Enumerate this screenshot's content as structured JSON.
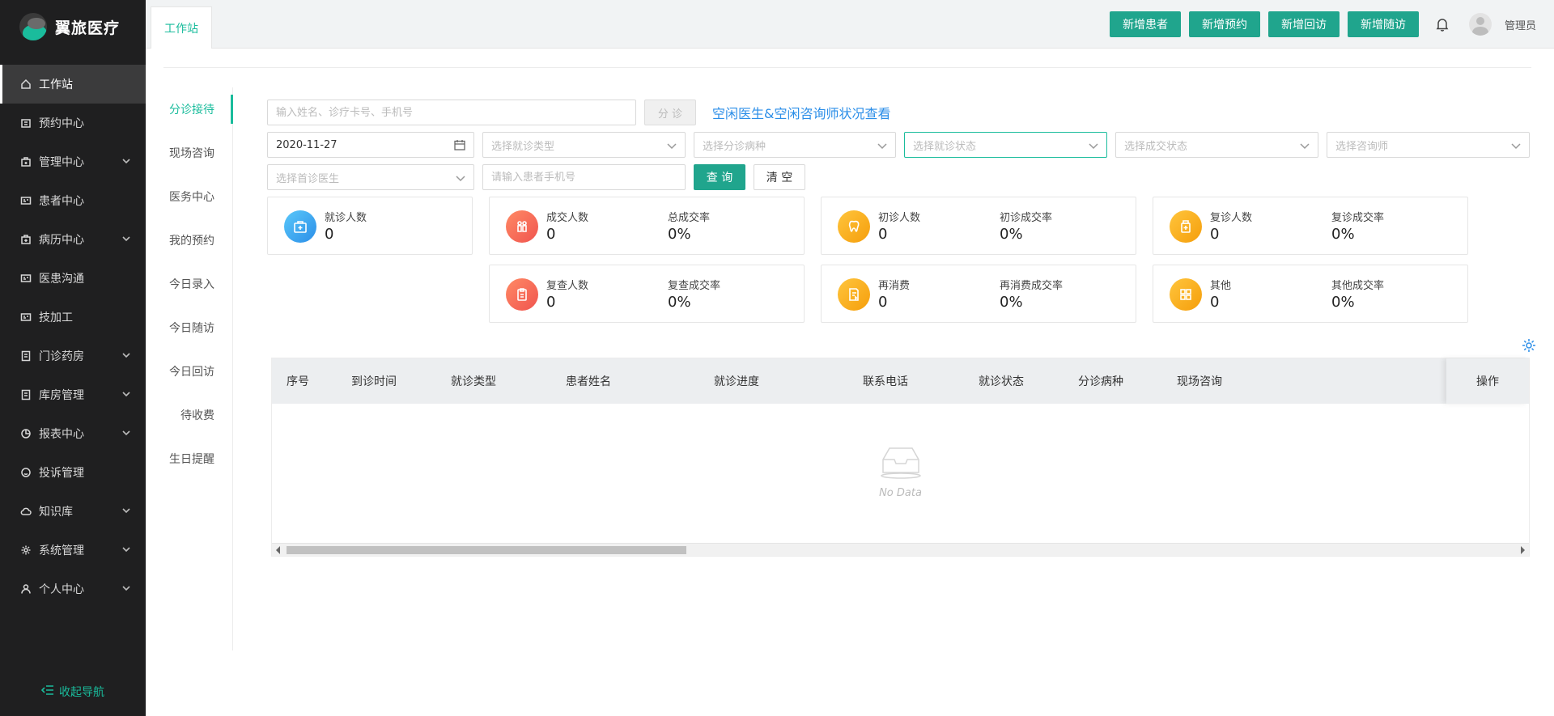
{
  "app": {
    "name": "翼旅医疗"
  },
  "sidebar": {
    "items": [
      {
        "label": "工作站",
        "icon": "home-icon",
        "expandable": false,
        "active": true
      },
      {
        "label": "预约中心",
        "icon": "calendar-icon",
        "expandable": false
      },
      {
        "label": "管理中心",
        "icon": "briefcase-icon",
        "expandable": true
      },
      {
        "label": "患者中心",
        "icon": "id-card-icon",
        "expandable": false
      },
      {
        "label": "病历中心",
        "icon": "medical-case-icon",
        "expandable": true
      },
      {
        "label": "医患沟通",
        "icon": "chat-card-icon",
        "expandable": false
      },
      {
        "label": "技加工",
        "icon": "tool-card-icon",
        "expandable": false
      },
      {
        "label": "门诊药房",
        "icon": "pharmacy-icon",
        "expandable": true
      },
      {
        "label": "库房管理",
        "icon": "warehouse-icon",
        "expandable": true
      },
      {
        "label": "报表中心",
        "icon": "pie-chart-icon",
        "expandable": true
      },
      {
        "label": "投诉管理",
        "icon": "smile-icon",
        "expandable": false
      },
      {
        "label": "知识库",
        "icon": "cloud-icon",
        "expandable": true
      },
      {
        "label": "系统管理",
        "icon": "gear-icon",
        "expandable": true
      },
      {
        "label": "个人中心",
        "icon": "user-icon",
        "expandable": true
      }
    ],
    "collapse_label": "收起导航"
  },
  "topbar": {
    "tab_label": "工作站",
    "buttons": [
      "新增患者",
      "新增预约",
      "新增回访",
      "新增随访"
    ],
    "user_name": "管理员"
  },
  "subnav": {
    "items": [
      "分诊接待",
      "现场咨询",
      "医务中心",
      "我的预约",
      "今日录入",
      "今日随访",
      "今日回访",
      "待收费",
      "生日提醒"
    ],
    "active_index": 0
  },
  "filters": {
    "search_placeholder": "输入姓名、诊疗卡号、手机号",
    "triage_button": "分 诊",
    "status_link": "空闲医生&空闲咨询师状况查看",
    "date_value": "2020-11-27",
    "visit_type_placeholder": "选择就诊类型",
    "triage_disease_placeholder": "选择分诊病种",
    "visit_status_placeholder": "选择就诊状态",
    "deal_status_placeholder": "选择成交状态",
    "consultant_placeholder": "选择咨询师",
    "first_doctor_placeholder": "选择首诊医生",
    "phone_placeholder": "请输入患者手机号",
    "query_button": "查 询",
    "clear_button": "清 空"
  },
  "stats": {
    "visits": {
      "label": "就诊人数",
      "value": "0"
    },
    "deals": {
      "label": "成交人数",
      "value": "0",
      "rate_label": "总成交率",
      "rate_value": "0%"
    },
    "first_visits": {
      "label": "初诊人数",
      "value": "0",
      "rate_label": "初诊成交率",
      "rate_value": "0%"
    },
    "return_visits": {
      "label": "复诊人数",
      "value": "0",
      "rate_label": "复诊成交率",
      "rate_value": "0%"
    },
    "rechecks": {
      "label": "复查人数",
      "value": "0",
      "rate_label": "复查成交率",
      "rate_value": "0%"
    },
    "reconsume": {
      "label": "再消费",
      "value": "0",
      "rate_label": "再消费成交率",
      "rate_value": "0%"
    },
    "other": {
      "label": "其他",
      "value": "0",
      "rate_label": "其他成交率",
      "rate_value": "0%"
    }
  },
  "table": {
    "columns": [
      "序号",
      "到诊时间",
      "就诊类型",
      "患者姓名",
      "就诊进度",
      "联系电话",
      "就诊状态",
      "分诊病种",
      "现场咨询"
    ],
    "op_column": "操作",
    "empty_text": "No Data"
  },
  "colors": {
    "accent": "#20a58d",
    "sidebar_bg": "#1f1f20",
    "link": "#2b8ee8"
  }
}
